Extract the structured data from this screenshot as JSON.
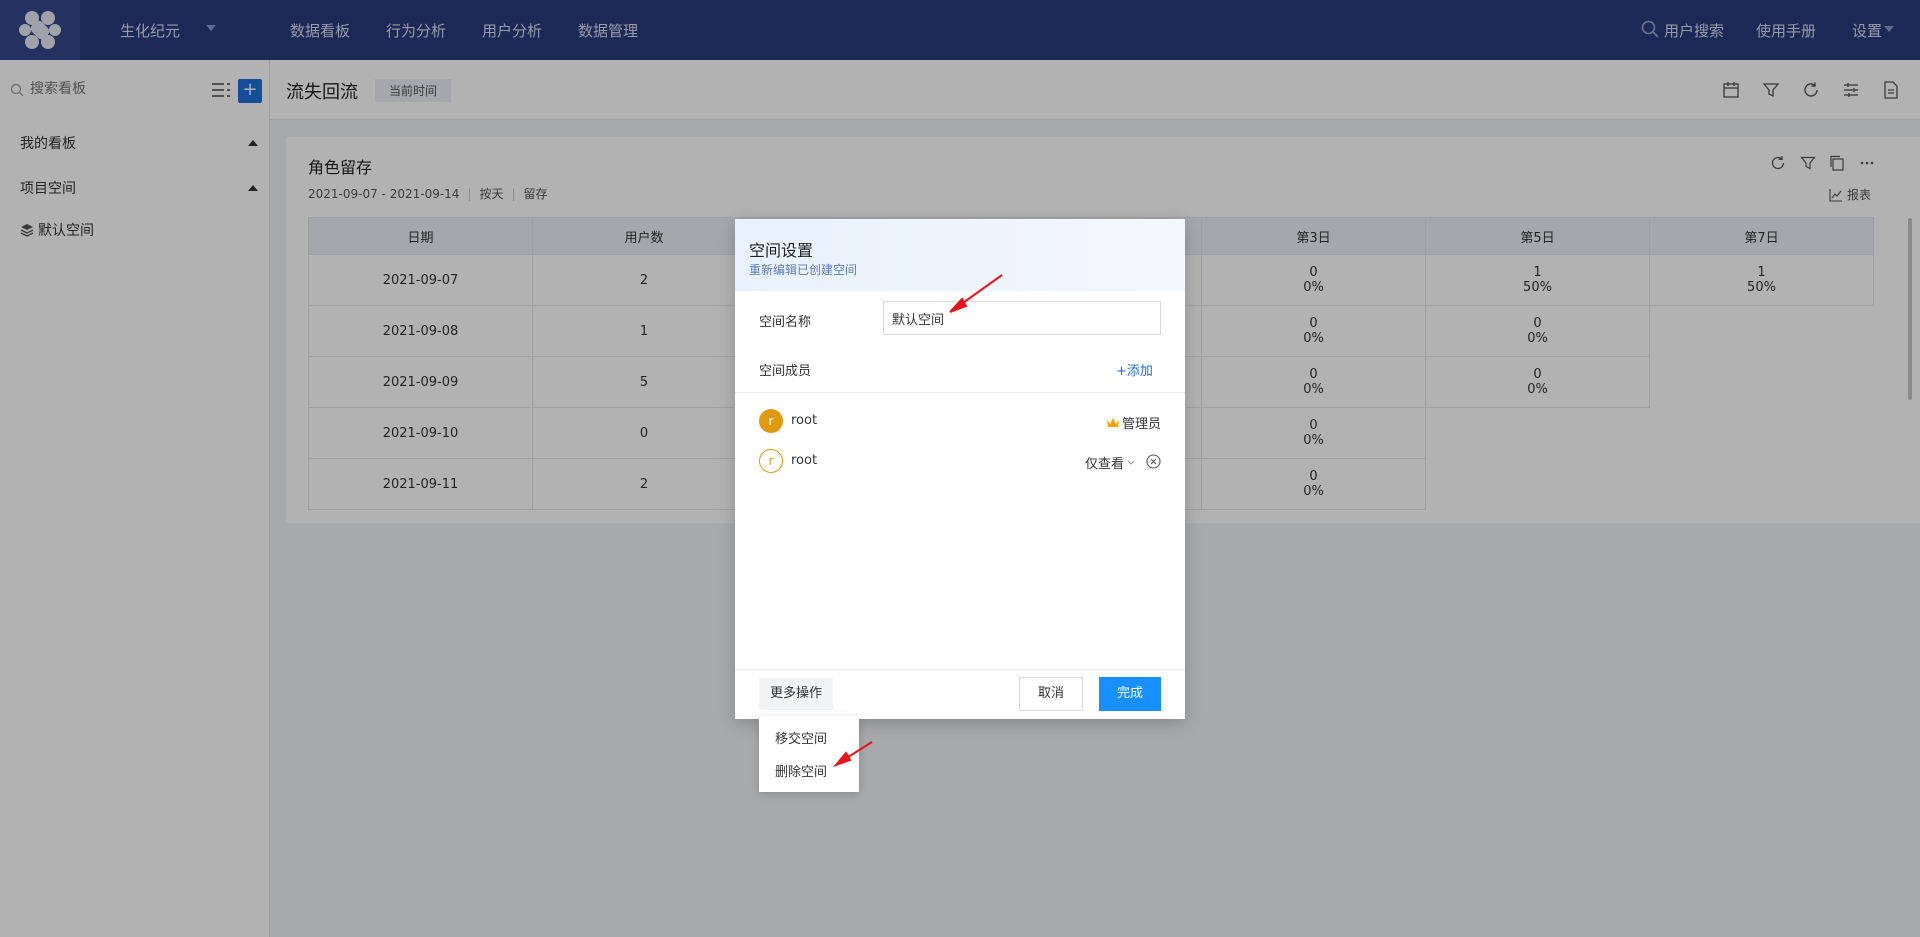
{
  "topbar": {
    "project": "生化纪元",
    "nav": [
      "数据看板",
      "行为分析",
      "用户分析",
      "数据管理"
    ],
    "user_search": "用户搜索",
    "manual": "使用手册",
    "settings": "设置"
  },
  "sidebar": {
    "search_placeholder": "搜索看板",
    "add_label": "+",
    "groups": [
      "我的看板",
      "项目空间"
    ],
    "space": "默认空间"
  },
  "header": {
    "title": "流失回流",
    "time_chip": "当前时间"
  },
  "card": {
    "title": "角色留存",
    "date_range": "2021-09-07 - 2021-09-14",
    "granularity": "按天",
    "metric": "留存",
    "report": "报表"
  },
  "table": {
    "headers": [
      "日期",
      "用户数",
      "",
      "",
      "第3日",
      "第5日",
      "第7日"
    ],
    "rows": [
      {
        "date": "2021-09-07",
        "users": "2",
        "d3": [
          "0",
          "0%"
        ],
        "d5": [
          "1",
          "50%"
        ],
        "d7": [
          "1",
          "50%"
        ]
      },
      {
        "date": "2021-09-08",
        "users": "1",
        "d3": [
          "0",
          "0%"
        ],
        "d5": [
          "0",
          "0%"
        ],
        "d7": null
      },
      {
        "date": "2021-09-09",
        "users": "5",
        "d3": [
          "0",
          "0%"
        ],
        "d5": [
          "0",
          "0%"
        ],
        "d7": null
      },
      {
        "date": "2021-09-10",
        "users": "0",
        "d3": [
          "0",
          "0%"
        ],
        "d5": null,
        "d7": null
      },
      {
        "date": "2021-09-11",
        "users": "2",
        "d3": [
          "0",
          "0%"
        ],
        "d5": null,
        "d7": null
      }
    ]
  },
  "modal": {
    "title": "空间设置",
    "subtitle": "重新编辑已创建空间",
    "name_label": "空间名称",
    "name_value": "默认空间",
    "members_label": "空间成员",
    "add_label": "+添加",
    "members": [
      {
        "initial": "r",
        "name": "root",
        "role": "管理员"
      },
      {
        "initial": "r",
        "name": "root",
        "role": "仅查看"
      }
    ],
    "more_label": "更多操作",
    "cancel_label": "取消",
    "done_label": "完成"
  },
  "dropdown": {
    "items": [
      "移交空间",
      "删除空间"
    ]
  },
  "colors": {
    "topbar": "#293a7c",
    "primary": "#1890ff",
    "avatar": "#e09a10",
    "annotation_arrow": "#e8141c"
  }
}
